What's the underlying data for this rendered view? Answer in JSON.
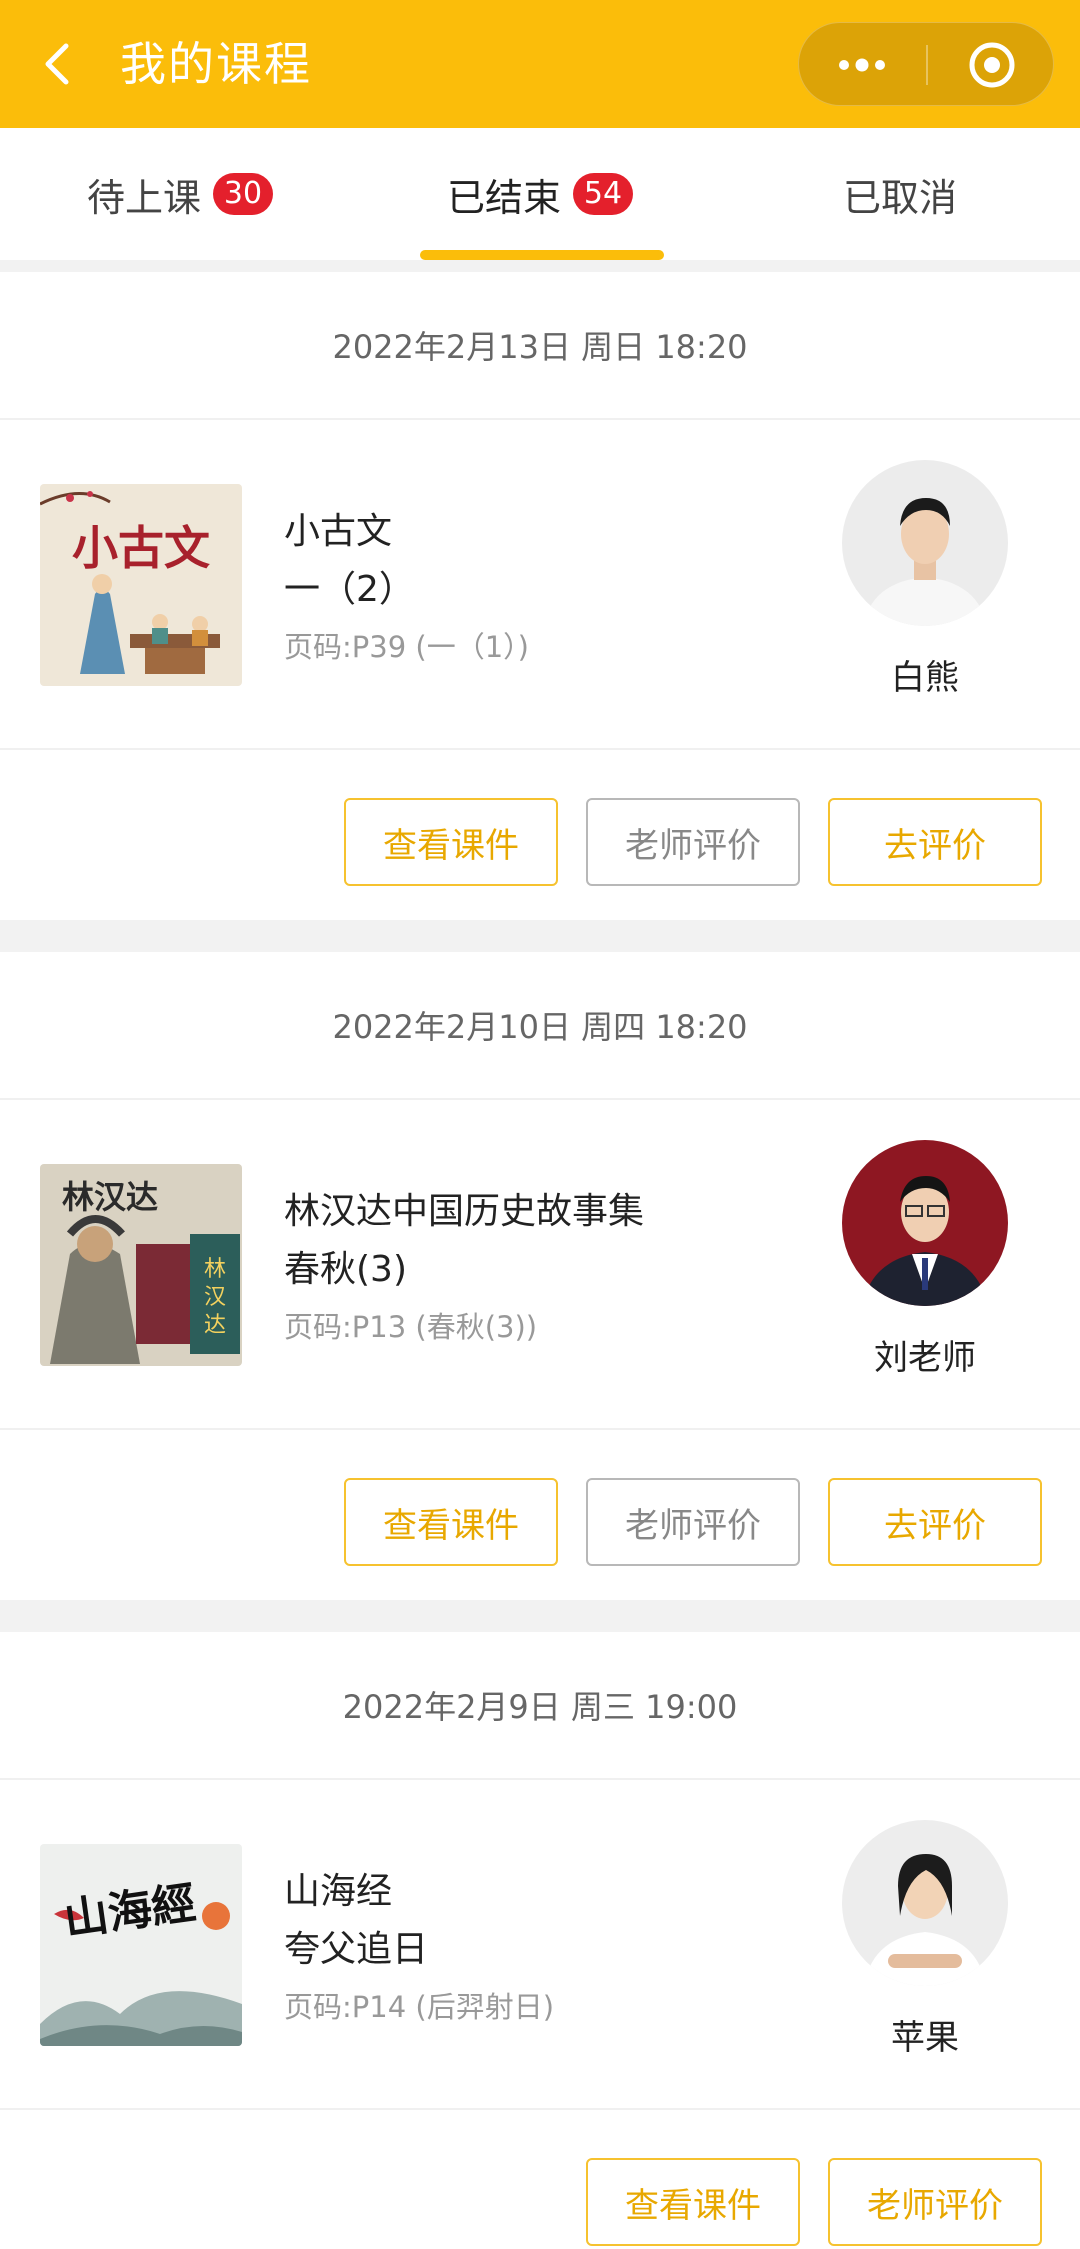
{
  "header": {
    "title": "我的课程",
    "back_icon": "chevron-left-icon",
    "more_icon": "more-dots-icon",
    "close_icon": "target-close-icon",
    "bg_color": "#fbbd0a"
  },
  "tabs": [
    {
      "label": "待上课",
      "badge": "30"
    },
    {
      "label": "已结束",
      "badge": "54",
      "active": true
    },
    {
      "label": "已取消",
      "badge": ""
    }
  ],
  "courses": [
    {
      "date": "2022年2月13日 周日 18:20",
      "name": "小古文",
      "lesson": "一（2）",
      "page": "页码:P39 (一（1）)",
      "teacher": "白熊",
      "thumb_text": "小古文",
      "buttons": [
        {
          "label": "查看课件",
          "style": "yellow"
        },
        {
          "label": "老师评价",
          "style": "gray"
        },
        {
          "label": "去评价",
          "style": "yellow"
        }
      ]
    },
    {
      "date": "2022年2月10日 周四 18:20",
      "name": "林汉达中国历史故事集",
      "lesson": "春秋(3)",
      "page": "页码:P13 (春秋(3))",
      "teacher": "刘老师",
      "thumb_text": "林汉达",
      "buttons": [
        {
          "label": "查看课件",
          "style": "yellow"
        },
        {
          "label": "老师评价",
          "style": "gray"
        },
        {
          "label": "去评价",
          "style": "yellow"
        }
      ]
    },
    {
      "date": "2022年2月9日 周三 19:00",
      "name": "山海经",
      "lesson": "夸父追日",
      "page": "页码:P14 (后羿射日)",
      "teacher": "苹果",
      "thumb_text": "山海經",
      "buttons": [
        {
          "label": "查看课件",
          "style": "yellow"
        },
        {
          "label": "老师评价",
          "style": "yellow"
        }
      ]
    }
  ]
}
